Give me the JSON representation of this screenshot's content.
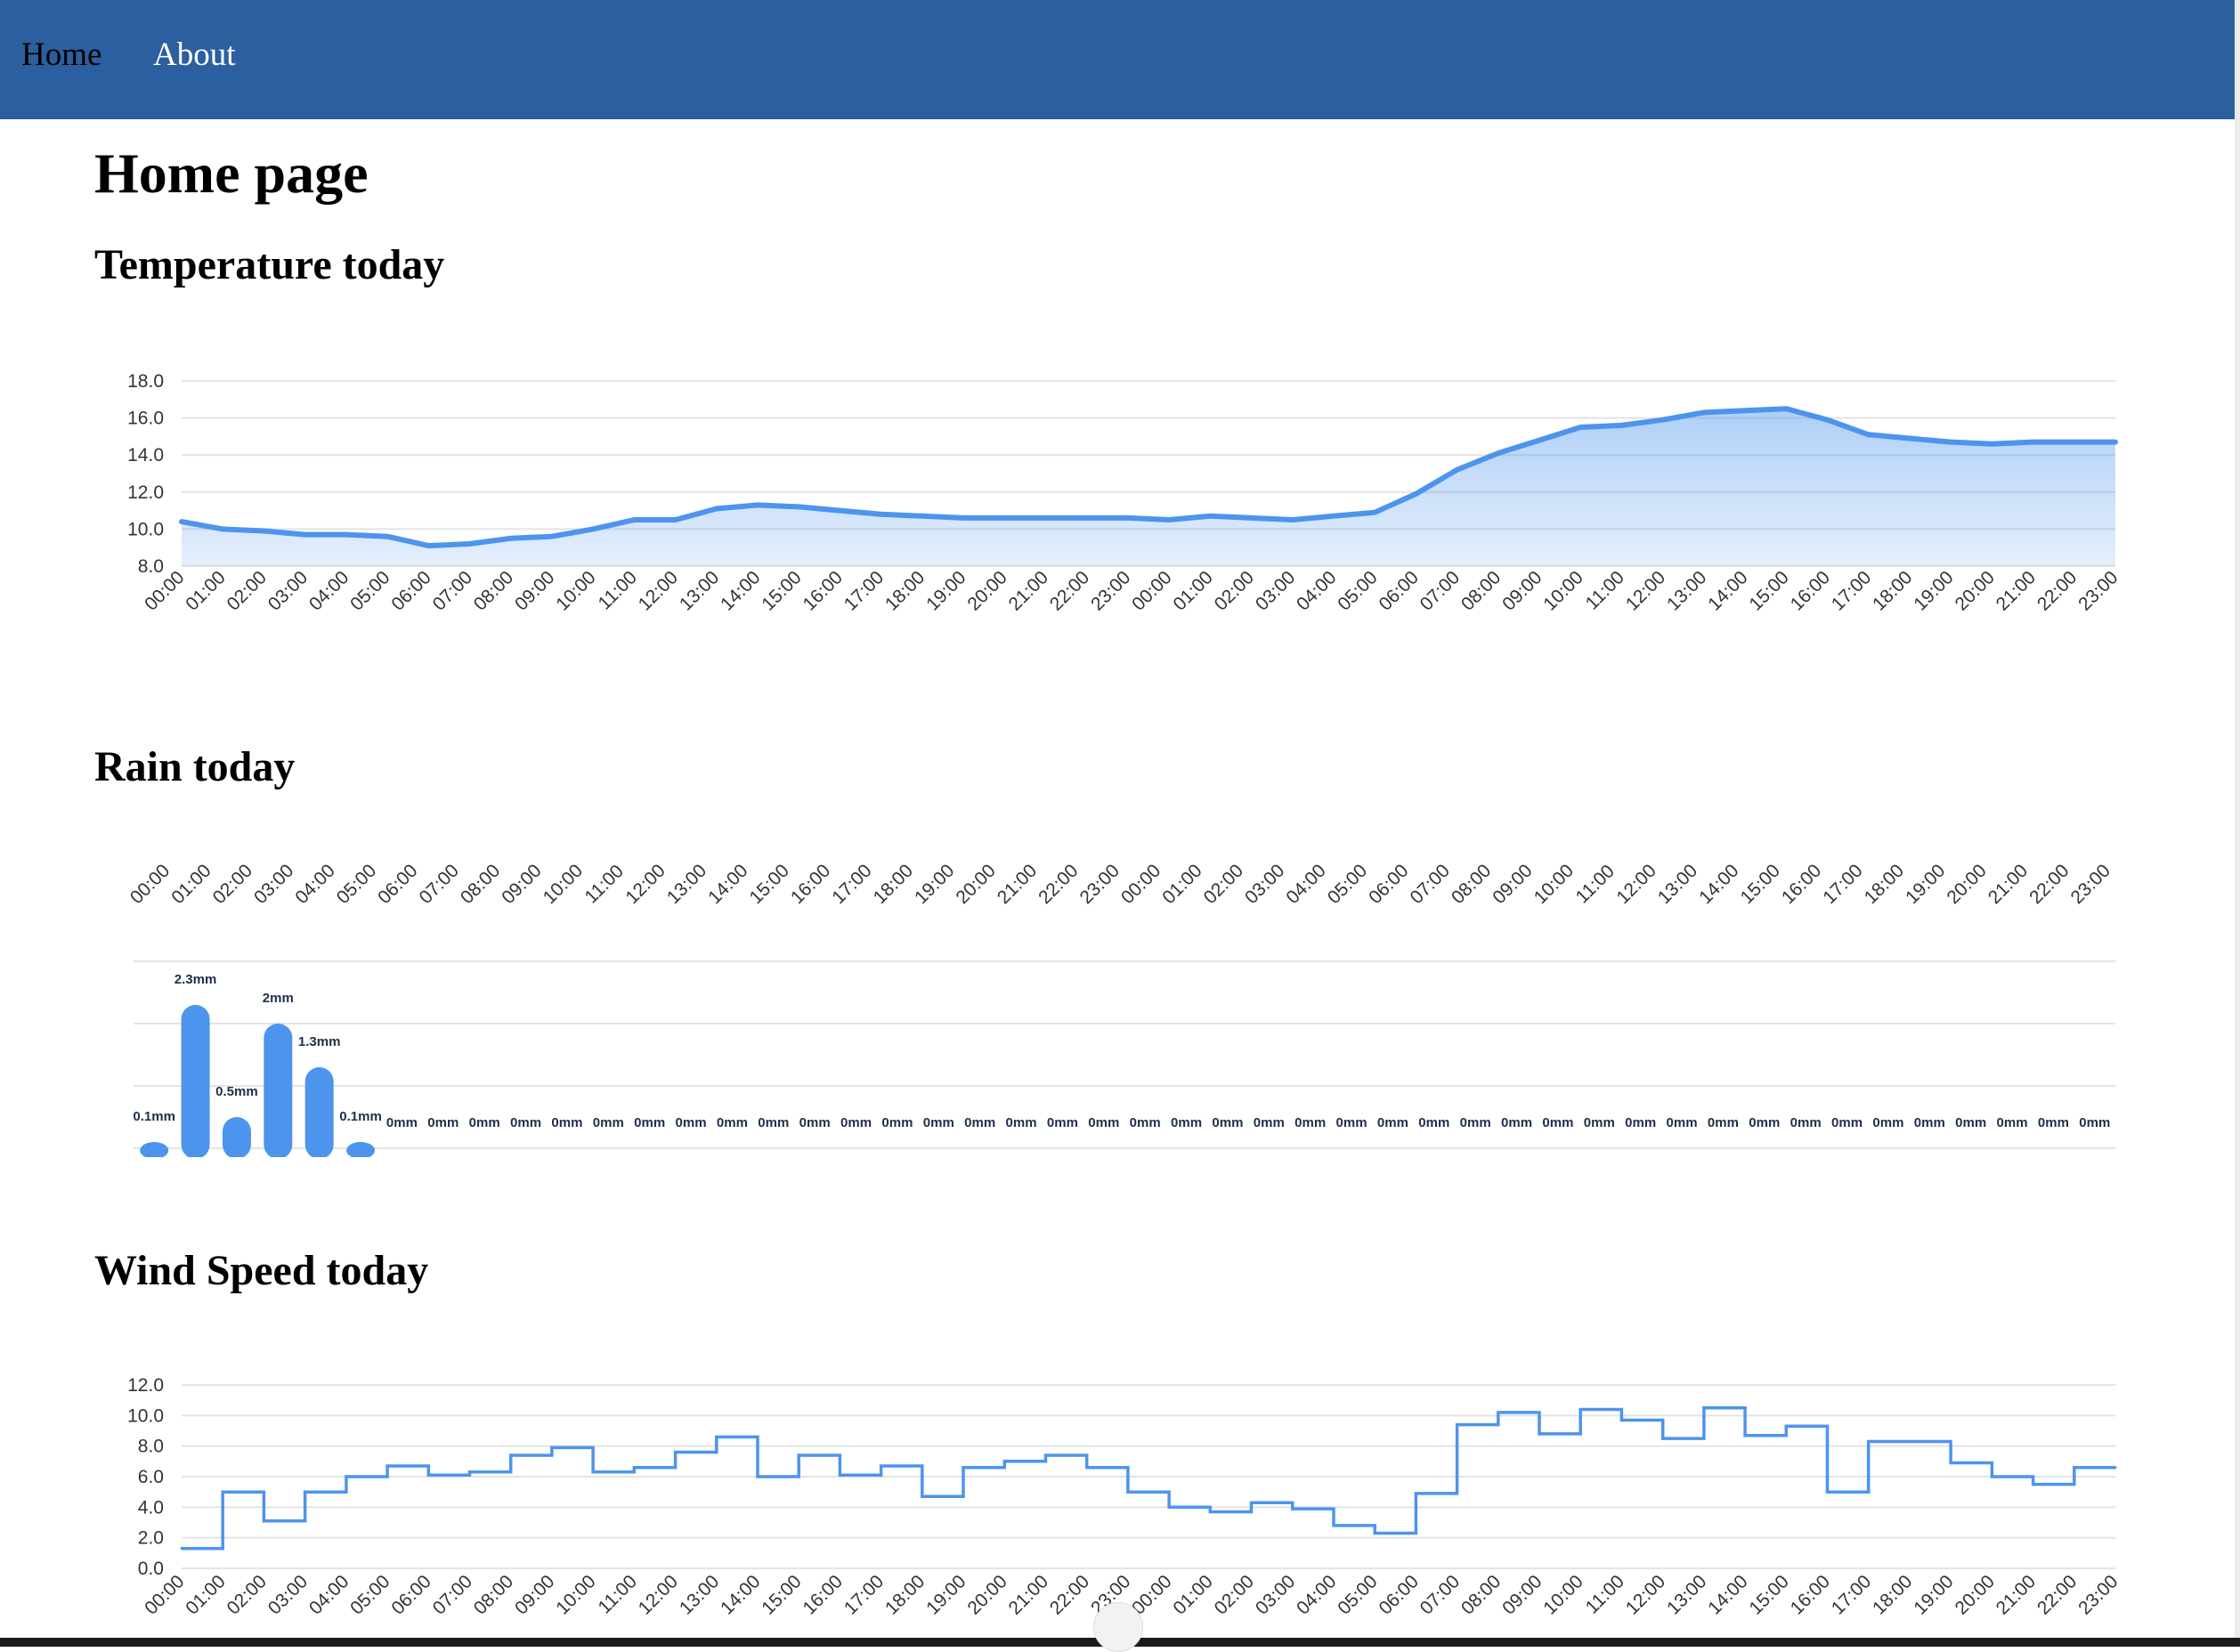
{
  "nav": {
    "home_label": "Home",
    "about_label": "About"
  },
  "page": {
    "title": "Home page"
  },
  "sections": {
    "temperature": {
      "heading": "Temperature today"
    },
    "rain": {
      "heading": "Rain today"
    },
    "wind": {
      "heading": "Wind Speed today"
    }
  },
  "colors": {
    "navbar": "#2c5f9f",
    "series": "#4d94ed",
    "grid": "#e4e4e4",
    "tick_text": "#333333",
    "data_label": "#1f2f4a"
  },
  "chart_data": [
    {
      "id": "temperature",
      "type": "area",
      "categories": [
        "00:00",
        "01:00",
        "02:00",
        "03:00",
        "04:00",
        "05:00",
        "06:00",
        "07:00",
        "08:00",
        "09:00",
        "10:00",
        "11:00",
        "12:00",
        "13:00",
        "14:00",
        "15:00",
        "16:00",
        "17:00",
        "18:00",
        "19:00",
        "20:00",
        "21:00",
        "22:00",
        "23:00",
        "00:00",
        "01:00",
        "02:00",
        "03:00",
        "04:00",
        "05:00",
        "06:00",
        "07:00",
        "08:00",
        "09:00",
        "10:00",
        "11:00",
        "12:00",
        "13:00",
        "14:00",
        "15:00",
        "16:00",
        "17:00",
        "18:00",
        "19:00",
        "20:00",
        "21:00",
        "22:00",
        "23:00"
      ],
      "values": [
        10.4,
        10.0,
        9.9,
        9.7,
        9.7,
        9.6,
        9.1,
        9.2,
        9.5,
        9.6,
        10.0,
        10.5,
        10.5,
        11.1,
        11.3,
        11.2,
        11.0,
        10.8,
        10.7,
        10.6,
        10.6,
        10.6,
        10.6,
        10.6,
        10.5,
        10.7,
        10.6,
        10.5,
        10.7,
        10.9,
        11.9,
        13.2,
        14.1,
        14.8,
        15.5,
        15.6,
        15.9,
        16.3,
        16.4,
        16.5,
        15.9,
        15.1,
        14.9,
        14.7,
        14.6,
        14.7,
        14.7,
        14.7
      ],
      "yticks": [
        "8.0",
        "10.0",
        "12.0",
        "14.0",
        "16.0",
        "18.0"
      ],
      "ylim": [
        8,
        18
      ],
      "grid": true
    },
    {
      "id": "rain",
      "type": "bar",
      "categories": [
        "00:00",
        "01:00",
        "02:00",
        "03:00",
        "04:00",
        "05:00",
        "06:00",
        "07:00",
        "08:00",
        "09:00",
        "10:00",
        "11:00",
        "12:00",
        "13:00",
        "14:00",
        "15:00",
        "16:00",
        "17:00",
        "18:00",
        "19:00",
        "20:00",
        "21:00",
        "22:00",
        "23:00",
        "00:00",
        "01:00",
        "02:00",
        "03:00",
        "04:00",
        "05:00",
        "06:00",
        "07:00",
        "08:00",
        "09:00",
        "10:00",
        "11:00",
        "12:00",
        "13:00",
        "14:00",
        "15:00",
        "16:00",
        "17:00",
        "18:00",
        "19:00",
        "20:00",
        "21:00",
        "22:00",
        "23:00"
      ],
      "values": [
        0.1,
        2.3,
        0.5,
        2,
        1.3,
        0.1,
        0,
        0,
        0,
        0,
        0,
        0,
        0,
        0,
        0,
        0,
        0,
        0,
        0,
        0,
        0,
        0,
        0,
        0,
        0,
        0,
        0,
        0,
        0,
        0,
        0,
        0,
        0,
        0,
        0,
        0,
        0,
        0,
        0,
        0,
        0,
        0,
        0,
        0,
        0,
        0,
        0,
        0
      ],
      "data_labels": [
        "0.1mm",
        "2.3mm",
        "0.5mm",
        "2mm",
        "1.3mm",
        "0.1mm",
        "0mm",
        "0mm",
        "0mm",
        "0mm",
        "0mm",
        "0mm",
        "0mm",
        "0mm",
        "0mm",
        "0mm",
        "0mm",
        "0mm",
        "0mm",
        "0mm",
        "0mm",
        "0mm",
        "0mm",
        "0mm",
        "0mm",
        "0mm",
        "0mm",
        "0mm",
        "0mm",
        "0mm",
        "0mm",
        "0mm",
        "0mm",
        "0mm",
        "0mm",
        "0mm",
        "0mm",
        "0mm",
        "0mm",
        "0mm",
        "0mm",
        "0mm",
        "0mm",
        "0mm",
        "0mm",
        "0mm",
        "0mm",
        "0mm"
      ],
      "ylim": [
        0,
        3
      ],
      "grid": true,
      "x_axis_position": "top"
    },
    {
      "id": "wind",
      "type": "line",
      "step": true,
      "categories": [
        "00:00",
        "01:00",
        "02:00",
        "03:00",
        "04:00",
        "05:00",
        "06:00",
        "07:00",
        "08:00",
        "09:00",
        "10:00",
        "11:00",
        "12:00",
        "13:00",
        "14:00",
        "15:00",
        "16:00",
        "17:00",
        "18:00",
        "19:00",
        "20:00",
        "21:00",
        "22:00",
        "23:00",
        "00:00",
        "01:00",
        "02:00",
        "03:00",
        "04:00",
        "05:00",
        "06:00",
        "07:00",
        "08:00",
        "09:00",
        "10:00",
        "11:00",
        "12:00",
        "13:00",
        "14:00",
        "15:00",
        "16:00",
        "17:00",
        "18:00",
        "19:00",
        "20:00",
        "21:00",
        "22:00",
        "23:00"
      ],
      "values": [
        1.3,
        5.0,
        3.1,
        5.0,
        6.0,
        6.7,
        6.1,
        6.3,
        7.4,
        7.9,
        6.3,
        6.6,
        7.6,
        8.6,
        6.0,
        7.4,
        6.1,
        6.7,
        4.7,
        6.6,
        7.0,
        7.4,
        6.6,
        5.0,
        4.0,
        3.7,
        4.3,
        3.9,
        2.8,
        2.3,
        4.9,
        9.4,
        10.2,
        8.8,
        10.4,
        9.7,
        8.5,
        10.5,
        8.7,
        9.3,
        5.0,
        8.3,
        8.3,
        6.9,
        6.0,
        5.5,
        6.6,
        6.6
      ],
      "yticks": [
        "0.0",
        "2.0",
        "4.0",
        "6.0",
        "8.0",
        "10.0",
        "12.0"
      ],
      "ylim": [
        0,
        12
      ],
      "grid": true
    }
  ]
}
